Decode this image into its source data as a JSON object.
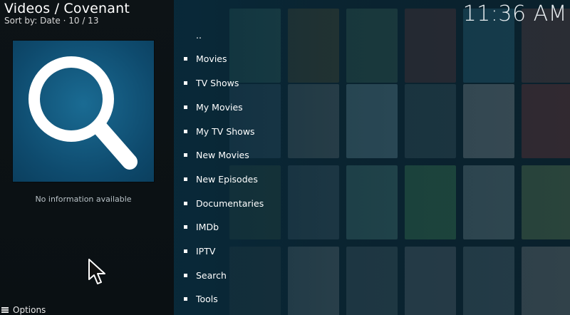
{
  "header": {
    "title": "Videos / Covenant",
    "sort_text": "Sort by: Date  ·  10 / 13"
  },
  "clock": "11:36 AM",
  "info_panel": {
    "thumbnail_icon": "search-icon",
    "message": "No information available"
  },
  "menu": {
    "items": [
      {
        "label": "..",
        "is_parent": true
      },
      {
        "label": "Movies"
      },
      {
        "label": "TV Shows"
      },
      {
        "label": "My Movies"
      },
      {
        "label": "My TV Shows"
      },
      {
        "label": "New Movies"
      },
      {
        "label": "New Episodes"
      },
      {
        "label": "Documentaries"
      },
      {
        "label": "IMDb"
      },
      {
        "label": "IPTV"
      },
      {
        "label": "Search"
      },
      {
        "label": "Tools"
      }
    ]
  },
  "footer": {
    "options_label": "Options"
  },
  "colors": {
    "background": "#0b1d26",
    "thumbnail_blue": "#0e4a6d"
  }
}
